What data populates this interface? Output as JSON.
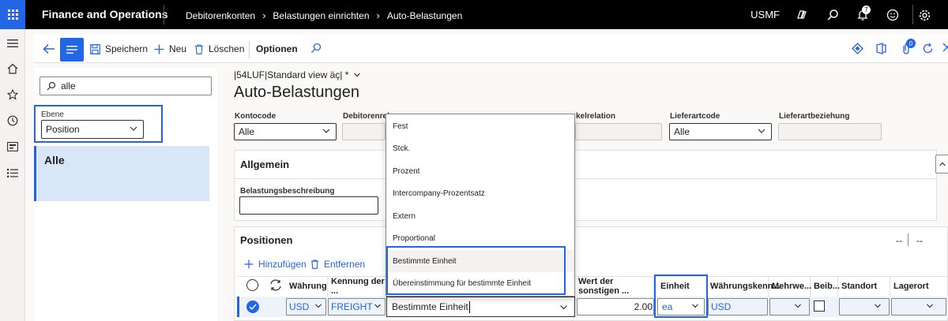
{
  "header": {
    "app_name": "Finance and Operations",
    "breadcrumbs": [
      "Debitorenkonten",
      "Belastungen einrichten",
      "Auto-Belastungen"
    ],
    "company": "USMF",
    "notification_count": "7"
  },
  "actionpane": {
    "save": "Speichern",
    "new": "Neu",
    "delete": "Löschen",
    "options": "Optionen",
    "attachments_count": "0"
  },
  "listpanel": {
    "search_value": "alle",
    "ebene_label": "Ebene",
    "ebene_value": "Position",
    "list_items": [
      "Alle"
    ]
  },
  "main": {
    "view_name": "|54LUF|Standard view äç| *",
    "title": "Auto-Belastungen",
    "fields": {
      "kontocode_label": "Kontocode",
      "kontocode_value": "Alle",
      "debitorenrelation_label": "Debitorenrela",
      "artikelrelation_label": "kelrelation",
      "lieferartcode_label": "Lieferartcode",
      "lieferartcode_value": "Alle",
      "lieferartbeziehung_label": "Lieferartbeziehung"
    },
    "allgemein": {
      "title": "Allgemein",
      "belastungsbeschreibung_label": "Belastungsbeschreibung"
    },
    "positionen": {
      "title": "Positionen",
      "add": "Hinzufügen",
      "remove": "Entfernen",
      "pager": [
        "--",
        "--"
      ],
      "columns": [
        "Währung",
        "Kennung der ...",
        "Wert der sonstigen ...",
        "Einheit",
        "Währungskenn...",
        "Mehrwe...",
        "Beib...",
        "Standort",
        "Lagerort"
      ],
      "row": {
        "currency": "USD",
        "kennung": "FREIGHT",
        "belastung": "Bestimmte Einheit",
        "wert": "2.00",
        "einheit": "ea",
        "waehrungskennung": "USD"
      }
    }
  },
  "dropdown": {
    "options": [
      "Fest",
      "Stck.",
      "Prozent",
      "Intercompany-Prozentsatz",
      "Extern",
      "Proportional",
      "Bestimmte Einheit",
      "Übereinstimmung für bestimmte Einheit"
    ],
    "selected": "Bestimmte Einheit"
  },
  "colors": {
    "accent": "#2266e3",
    "topbar": "#000000"
  }
}
